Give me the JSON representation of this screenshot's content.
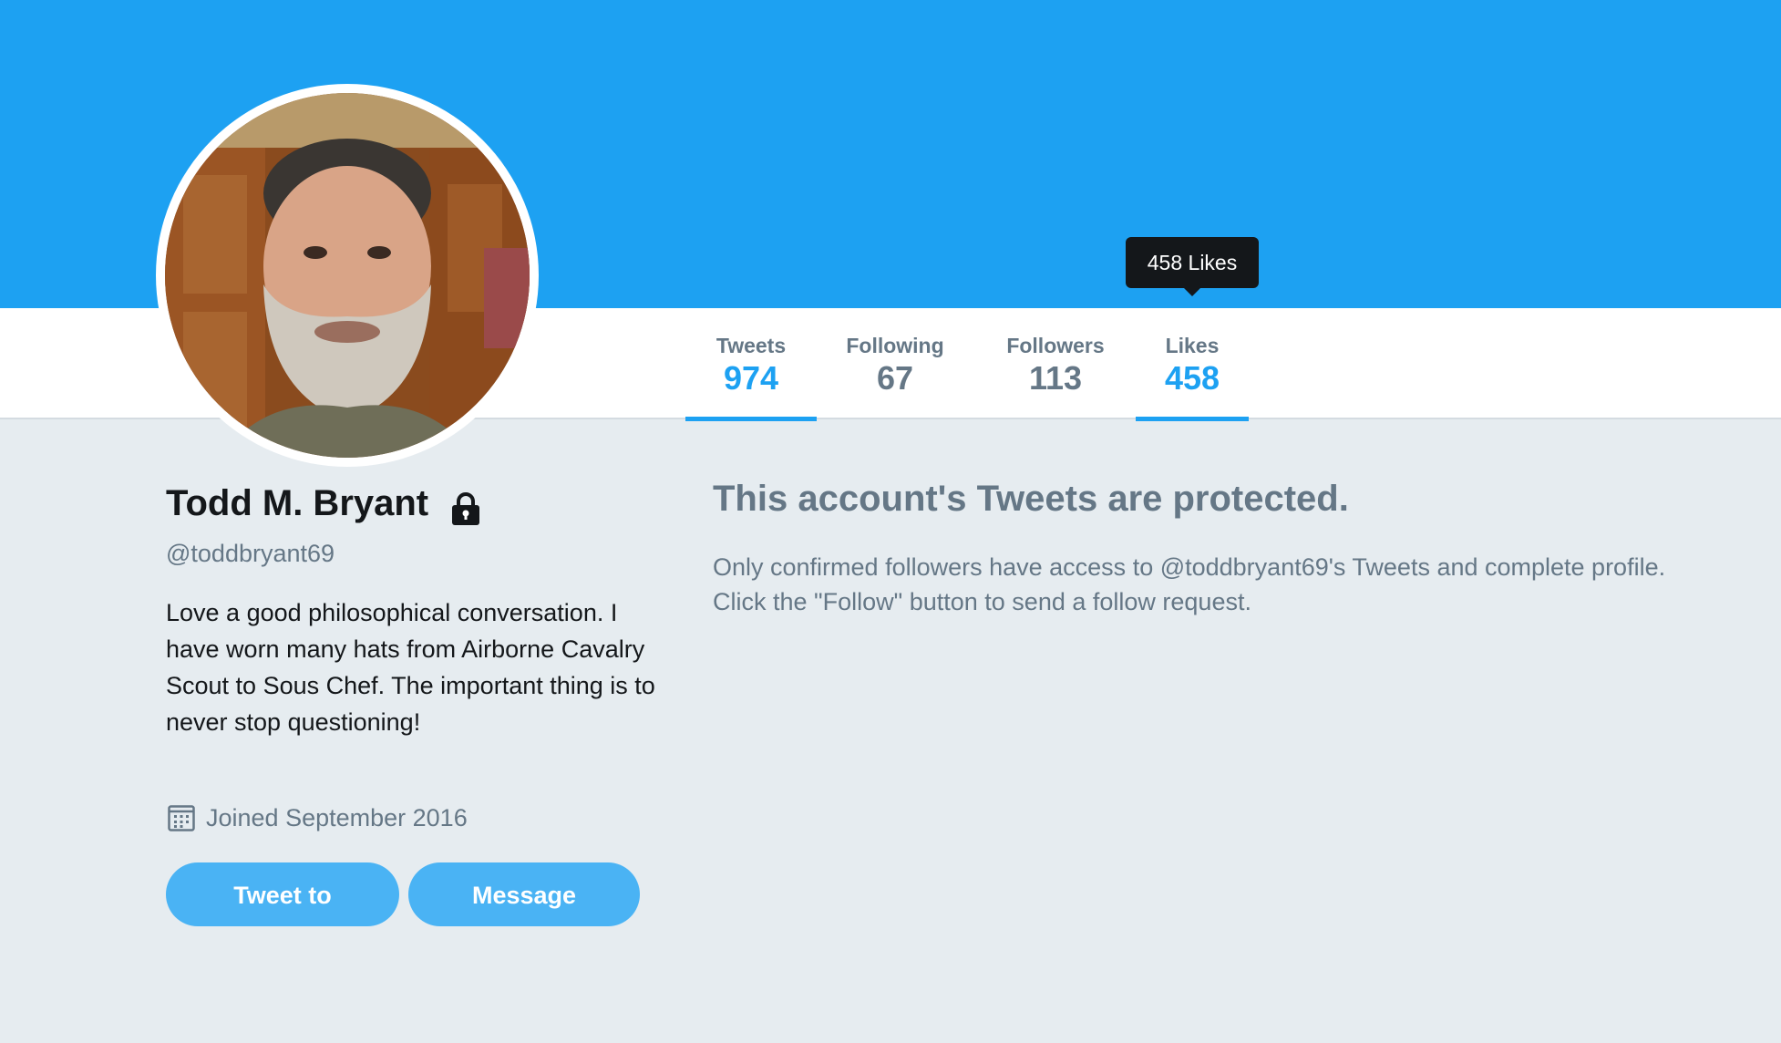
{
  "profile": {
    "name": "Todd M. Bryant",
    "handle": "@toddbryant69",
    "bio": "Love a good philosophical conversation. I have worn many hats from Airborne Cavalry Scout to Sous Chef. The important thing is to never stop questioning!",
    "joined": "Joined September 2016"
  },
  "nav": {
    "stats": [
      {
        "label": "Tweets",
        "value": "974",
        "active": true
      },
      {
        "label": "Following",
        "value": "67",
        "active": false
      },
      {
        "label": "Followers",
        "value": "113",
        "active": false
      },
      {
        "label": "Likes",
        "value": "458",
        "active": true
      }
    ],
    "tooltip": "458 Likes"
  },
  "actions": {
    "tweet_to": "Tweet to",
    "message": "Message"
  },
  "protected": {
    "title": "This account's Tweets are protected.",
    "line1": "Only confirmed followers have access to @toddbryant69's Tweets and complete profile.",
    "line2": "Click the \"Follow\" button to send a follow request."
  },
  "colors": {
    "brand_blue": "#1da1f2",
    "button_blue": "#4ab3f4",
    "page_background": "#e6ecf0",
    "secondary_text": "#657786",
    "primary_text": "#14171a"
  },
  "icons": {
    "lock": "lock-icon",
    "calendar": "calendar-icon"
  }
}
